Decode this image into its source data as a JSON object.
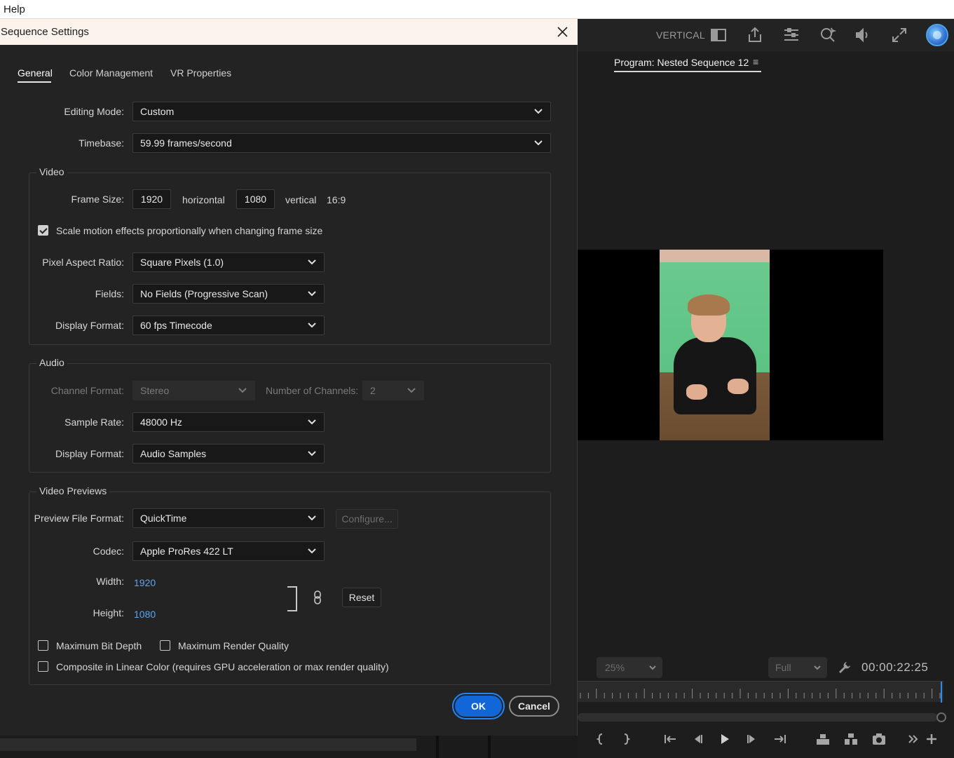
{
  "menubar": {
    "help": "Help"
  },
  "toolbar": {
    "workspace_label": "VERTICAL"
  },
  "program": {
    "tab_label": "Program: Nested Sequence 12",
    "zoom": "25%",
    "resolution": "Full",
    "timecode": "00:00:22:25"
  },
  "dialog": {
    "title": "Sequence Settings",
    "tabs": [
      "General",
      "Color Management",
      "VR Properties"
    ],
    "active_tab": "General",
    "editing_mode": {
      "label": "Editing Mode:",
      "value": "Custom"
    },
    "timebase": {
      "label": "Timebase:",
      "value": "59.99  frames/second"
    },
    "video": {
      "title": "Video",
      "frame_size_label": "Frame Size:",
      "width": "1920",
      "horizontal": "horizontal",
      "height": "1080",
      "vertical": "vertical",
      "aspect": "16:9",
      "scale_motion_label": "Scale motion effects proportionally when changing frame size",
      "scale_motion_checked": true,
      "par_label": "Pixel Aspect Ratio:",
      "par_value": "Square Pixels (1.0)",
      "fields_label": "Fields:",
      "fields_value": "No Fields (Progressive Scan)",
      "display_format_label": "Display Format:",
      "display_format_value": "60 fps Timecode"
    },
    "audio": {
      "title": "Audio",
      "channel_format_label": "Channel Format:",
      "channel_format_value": "Stereo",
      "channels_label": "Number of Channels:",
      "channels_value": "2",
      "sample_rate_label": "Sample Rate:",
      "sample_rate_value": "48000 Hz",
      "display_format_label": "Display Format:",
      "display_format_value": "Audio Samples"
    },
    "previews": {
      "title": "Video Previews",
      "file_format_label": "Preview File Format:",
      "file_format_value": "QuickTime",
      "configure": "Configure...",
      "codec_label": "Codec:",
      "codec_value": "Apple ProRes 422 LT",
      "width_label": "Width:",
      "width_value": "1920",
      "height_label": "Height:",
      "height_value": "1080",
      "reset": "Reset"
    },
    "options": {
      "max_bit_depth": "Maximum Bit Depth",
      "max_render_quality": "Maximum Render Quality",
      "linear_color": "Composite in Linear Color (requires GPU acceleration or max render quality)"
    },
    "ok": "OK",
    "cancel": "Cancel"
  },
  "icons": [
    "close-icon",
    "chevron-down-icon",
    "checkbox-icon",
    "link-icon",
    "wrench-icon",
    "play-icon",
    "camera-icon",
    "export-icon",
    "settings-icon",
    "volume-icon",
    "fullscreen-icon"
  ],
  "colors": {
    "accent": "#1166d8",
    "link_value": "#5ea4ef",
    "dialog_bg": "#232323",
    "titlebar_bg": "#fbf3ec"
  }
}
